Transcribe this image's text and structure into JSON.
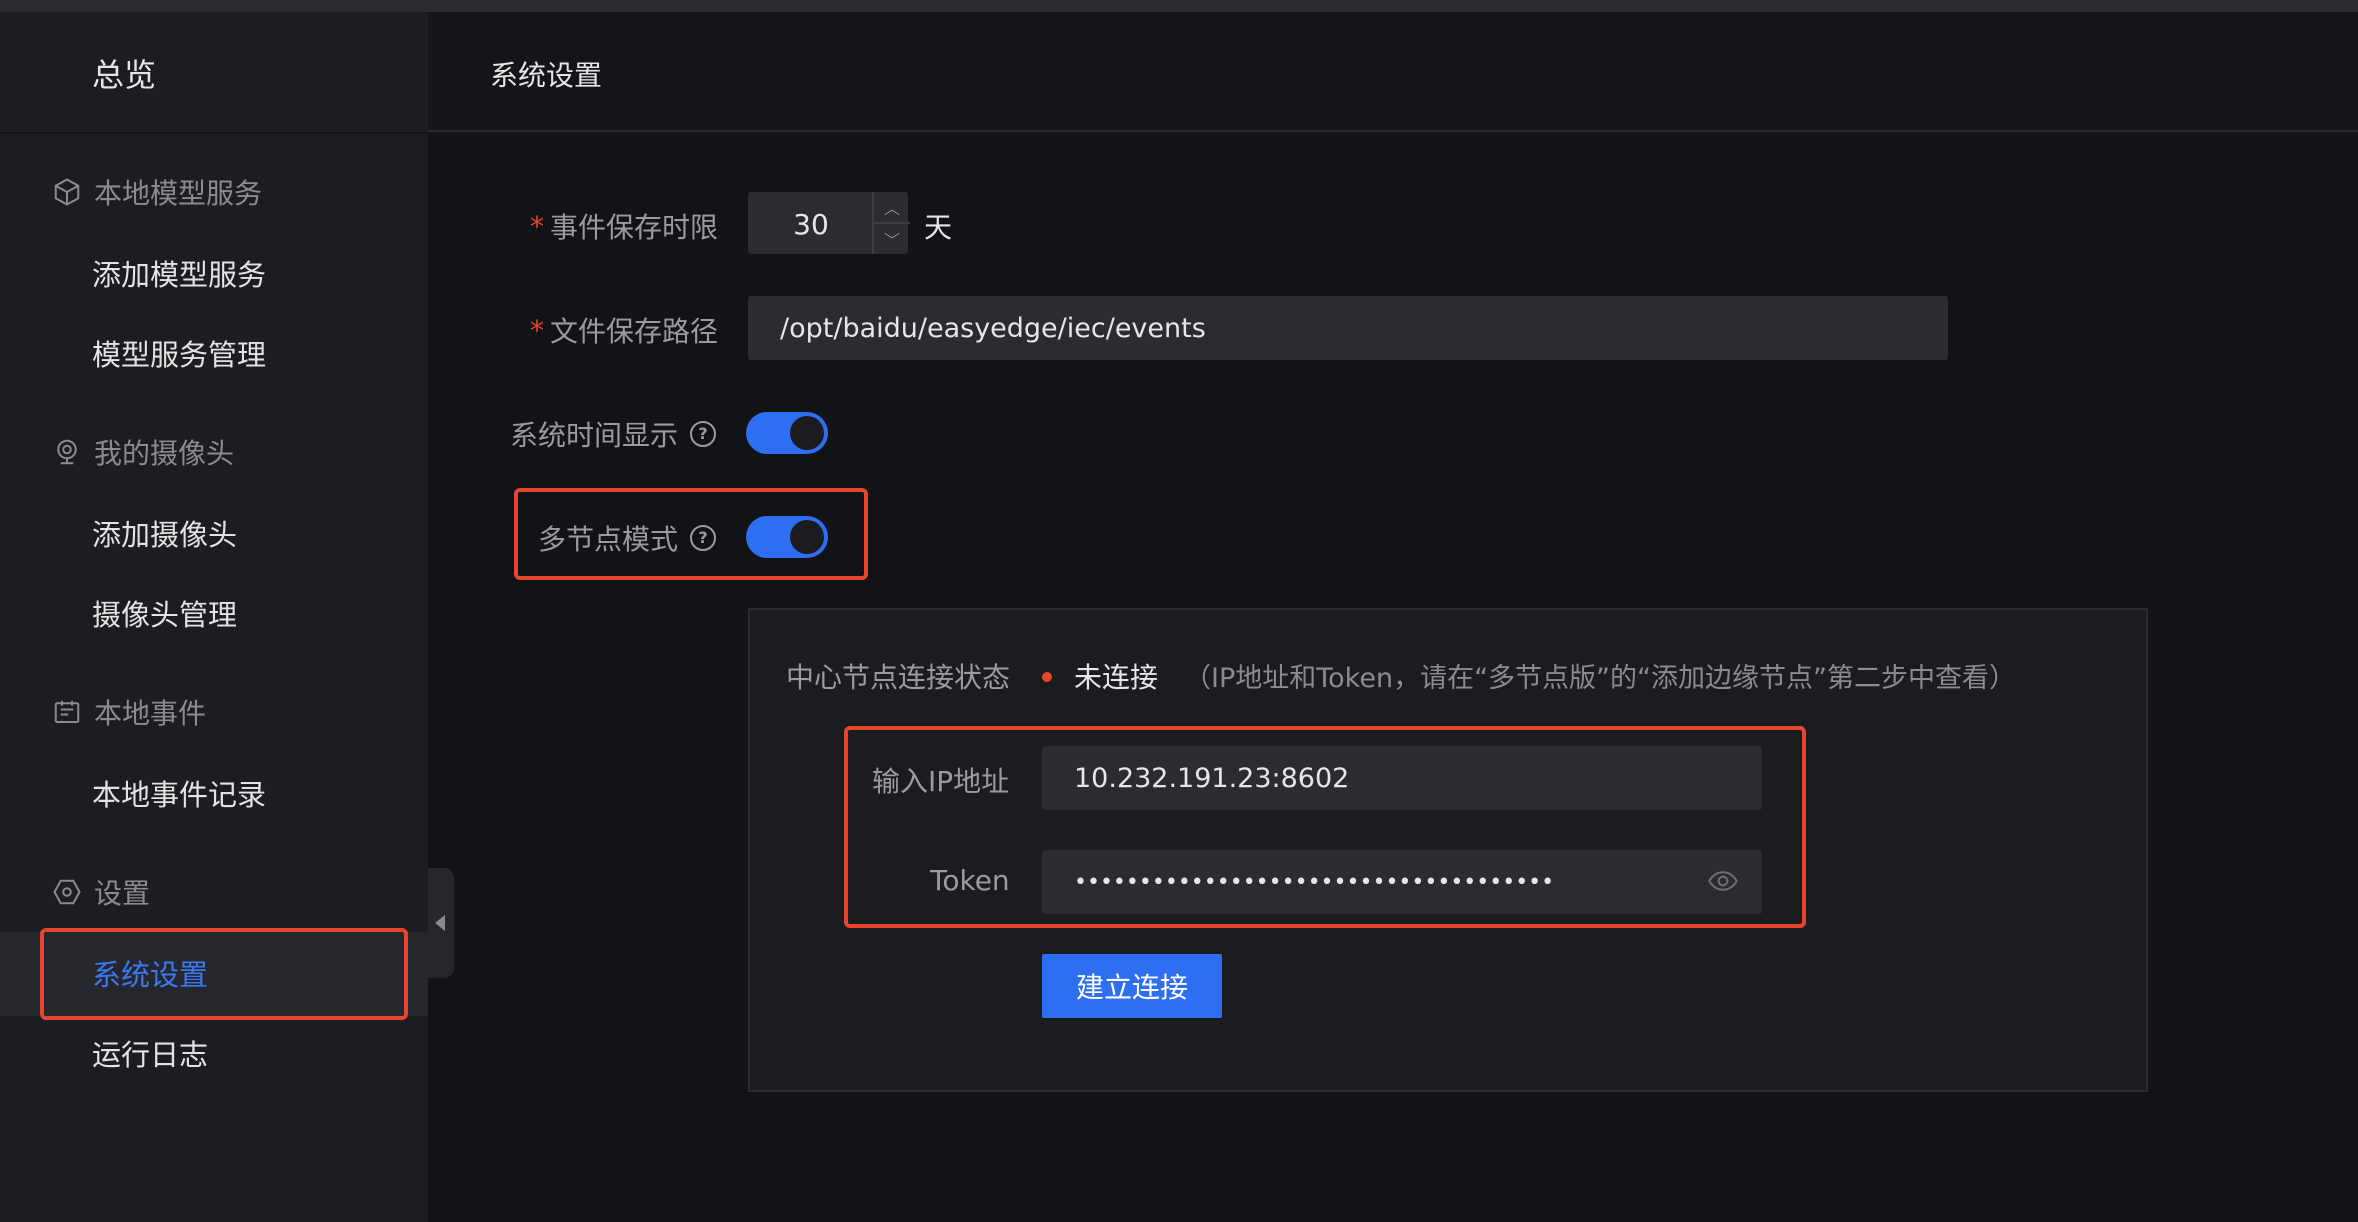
{
  "sidebar": {
    "overview": "总览",
    "groups": [
      {
        "title": "本地模型服务",
        "icon": "cube-icon",
        "items": [
          "添加模型服务",
          "模型服务管理"
        ]
      },
      {
        "title": "我的摄像头",
        "icon": "camera-icon",
        "items": [
          "添加摄像头",
          "摄像头管理"
        ]
      },
      {
        "title": "本地事件",
        "icon": "event-icon",
        "items": [
          "本地事件记录"
        ]
      },
      {
        "title": "设置",
        "icon": "settings-icon",
        "items": [
          "系统设置",
          "运行日志"
        ]
      }
    ],
    "active_item": "系统设置"
  },
  "header": {
    "title": "系统设置"
  },
  "form": {
    "event_retention": {
      "label": "事件保存时限",
      "value": "30",
      "unit": "天"
    },
    "file_path": {
      "label": "文件保存路径",
      "value": "/opt/baidu/easyedge/iec/events"
    },
    "system_time": {
      "label": "系统时间显示",
      "enabled": true
    },
    "multi_node": {
      "label": "多节点模式",
      "enabled": true
    }
  },
  "center_node": {
    "status_label": "中心节点连接状态",
    "status_value": "未连接",
    "status_color": "#e8452c",
    "hint": "（IP地址和Token，请在“多节点版”的“添加边缘节点”第二步中查看）",
    "ip_label": "输入IP地址",
    "ip_value": "10.232.191.23:8602",
    "token_label": "Token",
    "token_value": "•••••••••••••••••••••••••••••••••••••",
    "connect_button": "建立连接"
  },
  "colors": {
    "accent": "#2e6ef0",
    "highlight": "#e8452c",
    "active_text": "#3a78f2"
  }
}
